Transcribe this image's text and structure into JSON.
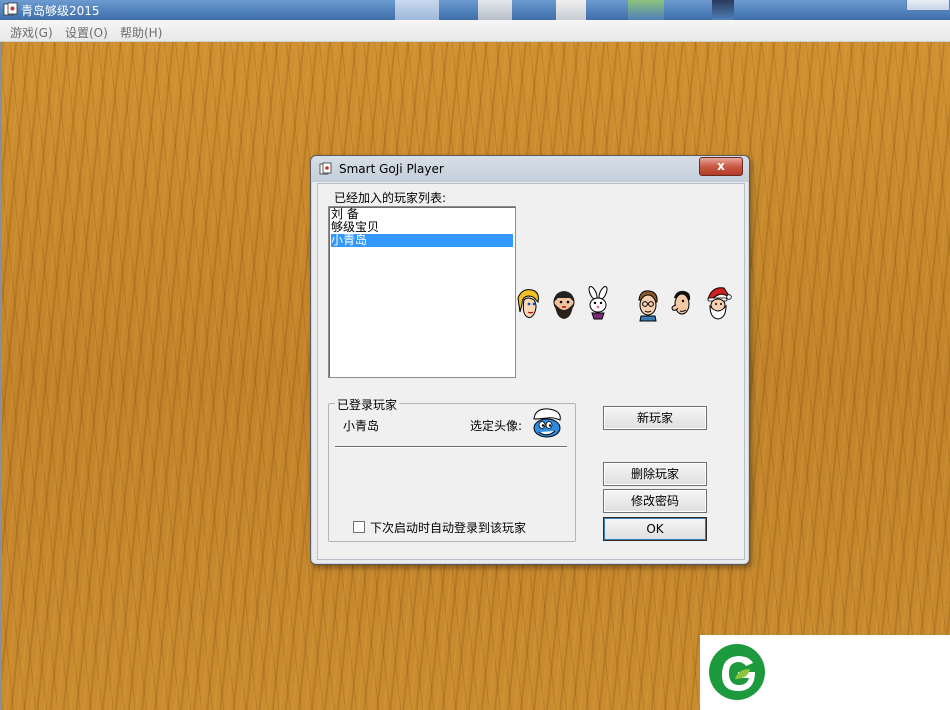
{
  "app": {
    "title": "青岛够级2015",
    "menu": [
      "游戏(G)",
      "设置(O)",
      "帮助(H)"
    ]
  },
  "dialog": {
    "title": "Smart GoJi Player",
    "close_glyph": "x",
    "list_label": "已经加入的玩家列表:",
    "players": [
      {
        "name": "刘  备",
        "selected": false
      },
      {
        "name": "够级宝贝",
        "selected": false
      },
      {
        "name": "小青岛",
        "selected": true
      }
    ],
    "avatars": [
      "blonde-girl-avatar",
      "bearded-man-avatar",
      "rabbit-avatar",
      "glasses-man-avatar",
      "big-nose-man-avatar",
      "santa-avatar"
    ],
    "logged_in": {
      "legend": "已登录玩家",
      "player_name": "小青岛",
      "avatar_label": "选定头像:",
      "avatar_icon": "smurf-avatar",
      "auto_login_label": "下次启动时自动登录到该玩家",
      "auto_login_checked": false
    },
    "buttons": {
      "new_player": "新玩家",
      "delete_player": "删除玩家",
      "change_password": "修改密码",
      "ok": "OK"
    }
  },
  "colors": {
    "wood": "#c98a2a",
    "selection": "#3399ff",
    "logo_green": "#1e9a3e"
  }
}
